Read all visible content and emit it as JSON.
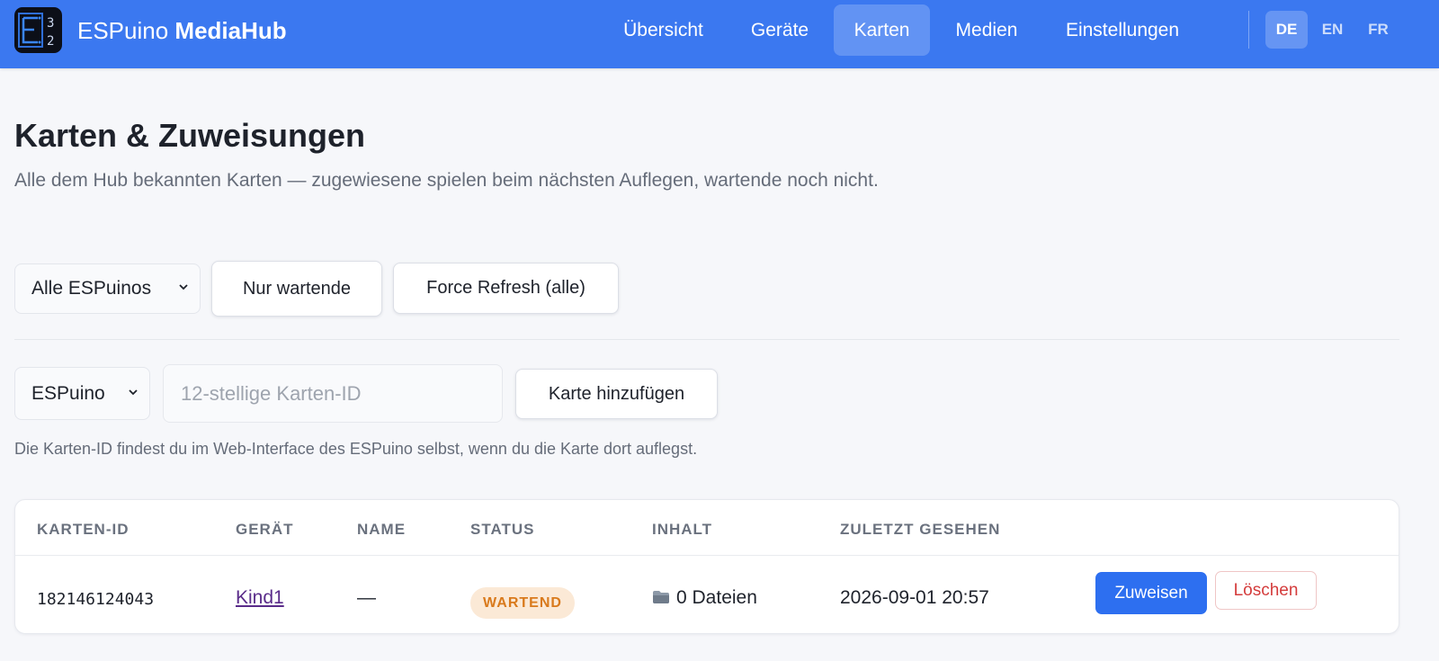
{
  "header": {
    "brand_part1": "ESPuino",
    "brand_part2": "MediaHub",
    "nav": [
      {
        "label": "Übersicht"
      },
      {
        "label": "Geräte"
      },
      {
        "label": "Karten",
        "active": true
      },
      {
        "label": "Medien"
      },
      {
        "label": "Einstellungen"
      }
    ],
    "languages": [
      {
        "label": "DE",
        "active": true
      },
      {
        "label": "EN"
      },
      {
        "label": "FR"
      }
    ]
  },
  "page": {
    "title": "Karten & Zuweisungen",
    "subtitle": "Alle dem Hub bekannten Karten — zugewiesene spielen beim nächsten Auflegen, wartende noch nicht."
  },
  "filters": {
    "device_select_value": "Alle ESPuinos",
    "only_pending_label": "Nur wartende",
    "force_refresh_label": "Force Refresh (alle)"
  },
  "add_card": {
    "device_select_value": "ESPuino",
    "card_id_placeholder": "12-stellige Karten-ID",
    "add_label": "Karte hinzufügen",
    "hint": "Die Karten-ID findest du im Web-Interface des ESPuino selbst, wenn du die Karte dort auflegst."
  },
  "table": {
    "columns": [
      "KARTEN-ID",
      "GERÄT",
      "NAME",
      "STATUS",
      "INHALT",
      "ZULETZT GESEHEN"
    ],
    "rows": [
      {
        "card_id": "182146124043",
        "device": "Kind1",
        "name": "—",
        "status": "WARTEND",
        "content": "0 Dateien",
        "content_icon": "folder-icon",
        "last_seen": "2026-09-01 20:57",
        "assign_label": "Zuweisen",
        "delete_label": "Löschen"
      }
    ]
  },
  "colors": {
    "primary": "#3b78f0",
    "button_primary": "#2d6ff0",
    "badge_pending_bg": "#fbe9d6",
    "badge_pending_text": "#d97a1c",
    "danger": "#d43c3c"
  }
}
